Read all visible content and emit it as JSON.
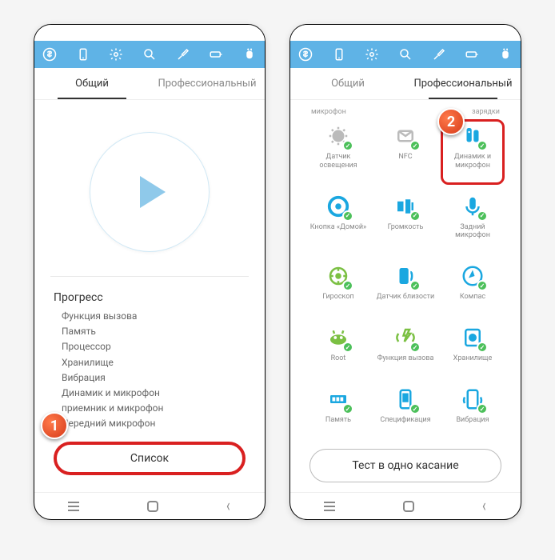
{
  "left": {
    "tabs": {
      "general": "Общий",
      "pro": "Профессиональный"
    },
    "progress_title": "Прогресс",
    "progress_items": [
      "Функция вызова",
      "Память",
      "Процессор",
      "Хранилище",
      "Вибрация",
      "Динамик и микрофон",
      "приемник и микрофон",
      "Передний микрофон"
    ],
    "list_button": "Список",
    "callout": "1"
  },
  "right": {
    "tabs": {
      "general": "Общий",
      "pro": "Профессиональный"
    },
    "top_row": {
      "left": "микрофон",
      "right": "зарядки"
    },
    "grid": [
      {
        "label": "Датчик освещения",
        "color": "#bbb"
      },
      {
        "label": "NFC",
        "color": "#bbb"
      },
      {
        "label": "Динамик и микрофон",
        "color": "#1aa7e0",
        "highlight": true
      },
      {
        "label": "Кнопка «Домой»",
        "color": "#1aa7e0"
      },
      {
        "label": "Громкость",
        "color": "#1aa7e0"
      },
      {
        "label": "Задний микрофон",
        "color": "#1aa7e0"
      },
      {
        "label": "Гироскоп",
        "color": "#7bc043"
      },
      {
        "label": "Датчик близости",
        "color": "#1aa7e0"
      },
      {
        "label": "Компас",
        "color": "#1aa7e0"
      },
      {
        "label": "Root",
        "color": "#7bc043"
      },
      {
        "label": "Функция вызова",
        "color": "#7bc043"
      },
      {
        "label": "Хранилище",
        "color": "#1aa7e0"
      },
      {
        "label": "Память",
        "color": "#1aa7e0"
      },
      {
        "label": "Спецификация",
        "color": "#1aa7e0"
      },
      {
        "label": "Вибрация",
        "color": "#1aa7e0"
      }
    ],
    "test_button": "Тест в одно касание",
    "callout": "2"
  }
}
